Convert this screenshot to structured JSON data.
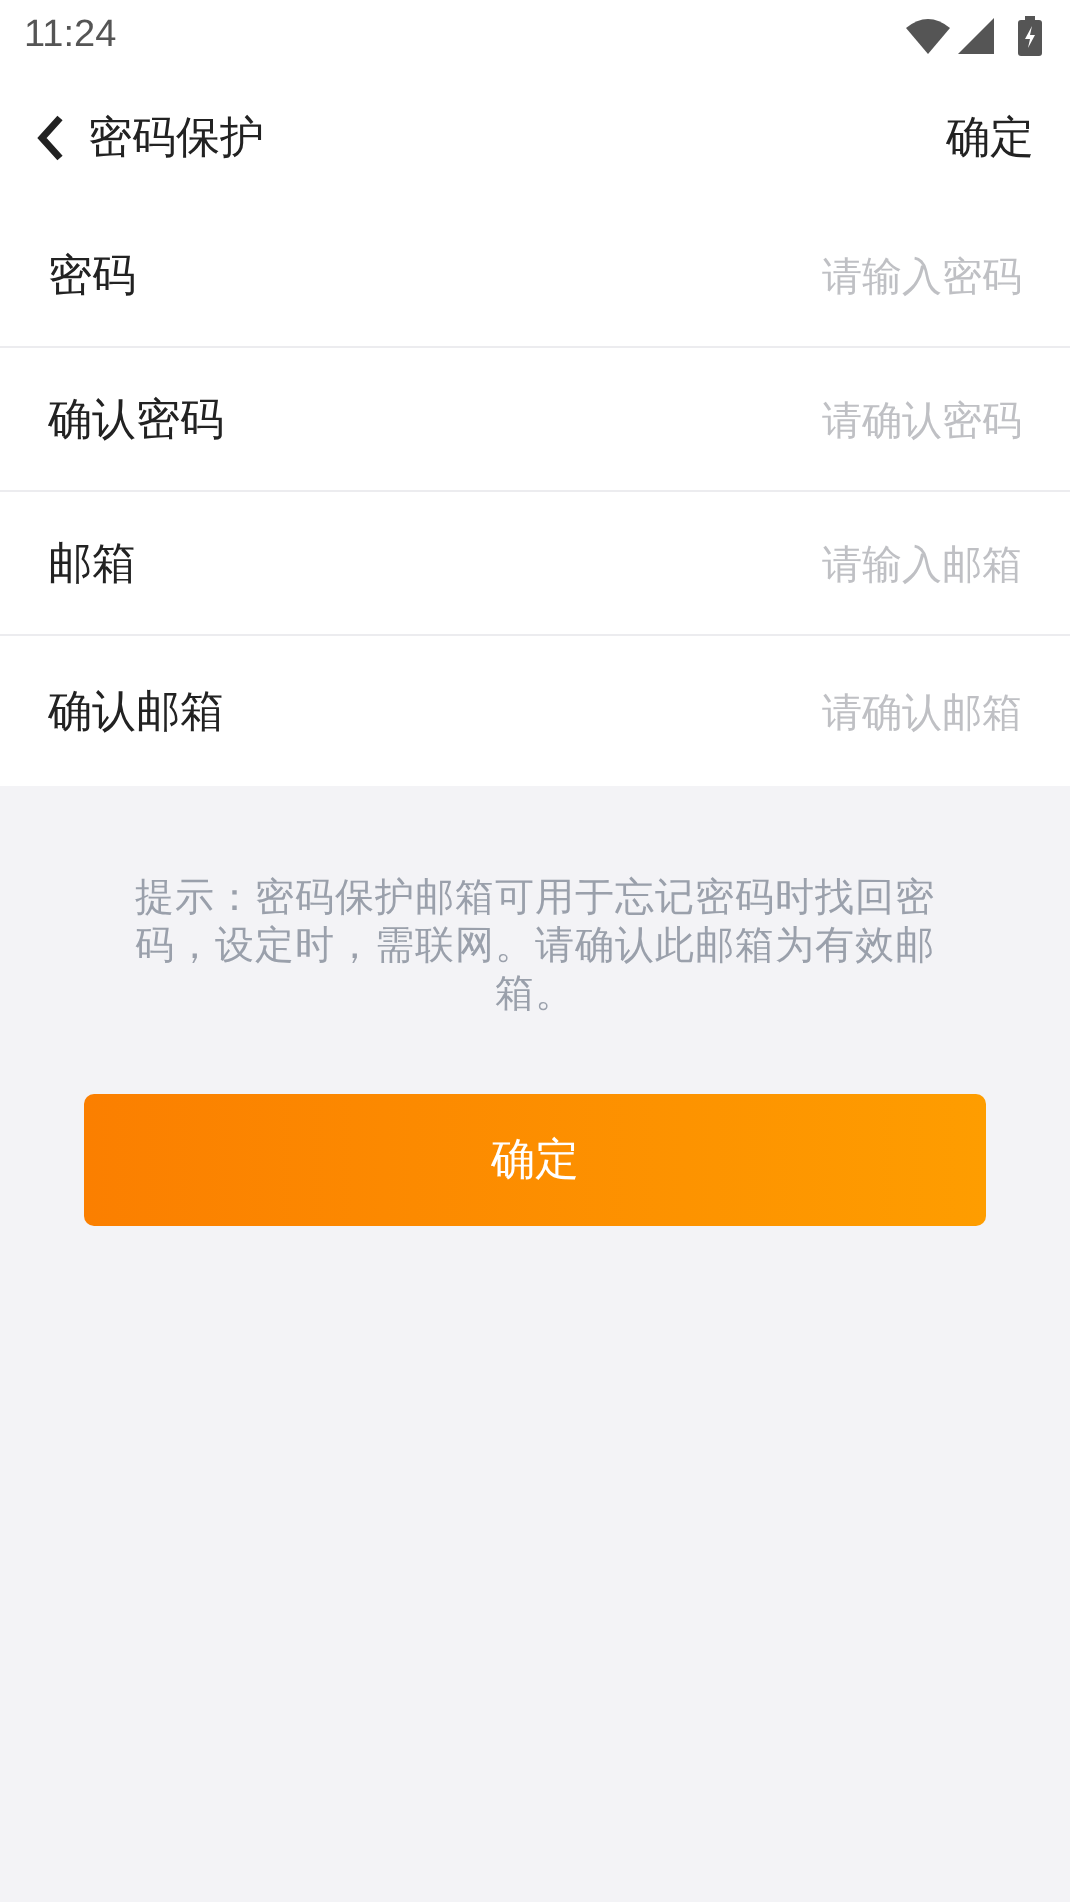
{
  "status_bar": {
    "time": "11:24"
  },
  "header": {
    "title": "密码保护",
    "action": "确定"
  },
  "fields": [
    {
      "label": "密码",
      "placeholder": "请输入密码"
    },
    {
      "label": "确认密码",
      "placeholder": "请确认密码"
    },
    {
      "label": "邮箱",
      "placeholder": "请输入邮箱"
    },
    {
      "label": "确认邮箱",
      "placeholder": "请确认邮箱"
    }
  ],
  "hint": "提示：密码保护邮箱可用于忘记密码时找回密码，设定时，需联网。请确认此邮箱为有效邮箱。",
  "submit_button": "确定"
}
